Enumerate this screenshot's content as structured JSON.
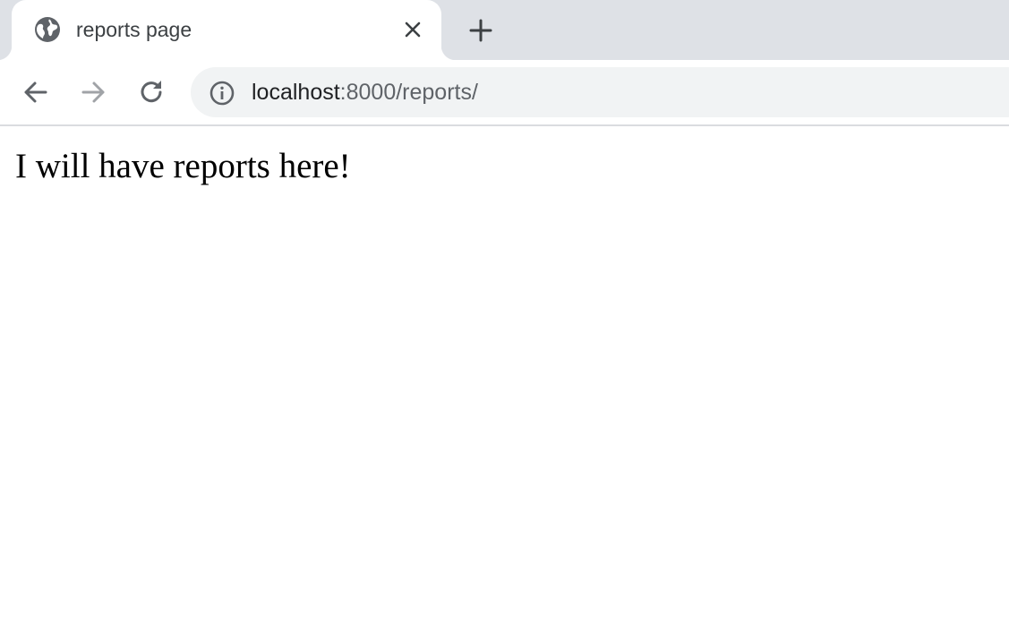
{
  "tab": {
    "title": "reports page",
    "favicon": "globe-icon"
  },
  "toolbar": {
    "back_icon": "arrow-left-icon",
    "forward_icon": "arrow-right-icon",
    "reload_icon": "reload-icon",
    "address": {
      "host": "localhost",
      "rest": ":8000/reports/",
      "security_icon": "info-icon"
    }
  },
  "page": {
    "body_text": "I will have reports here!"
  },
  "colors": {
    "tab_strip": "#dee1e6",
    "omnibox": "#f1f3f4",
    "icon": "#5f6368",
    "icon_disabled": "#a0a3a7"
  }
}
